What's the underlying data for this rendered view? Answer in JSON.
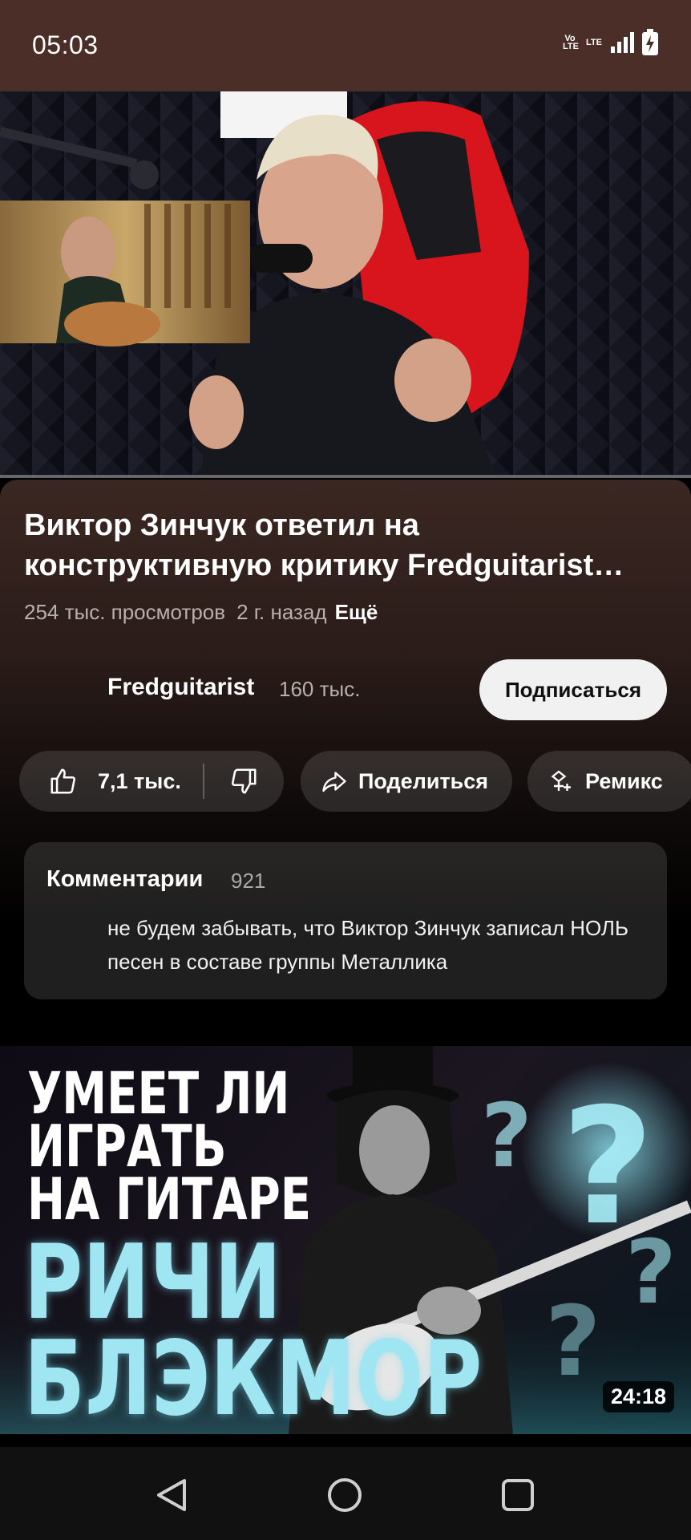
{
  "status_bar": {
    "time": "05:03",
    "volte_label": "Vo\nLTE",
    "lte_label": "LTE",
    "icons": [
      "volte-icon",
      "lte-icon",
      "signal-icon",
      "battery-charging-icon"
    ]
  },
  "player": {
    "progress_fraction": 0.0
  },
  "video": {
    "title": "Виктор Зинчук ответил на конструктивную критику Fredguitarist…",
    "views": "254 тыс. просмотров",
    "age": "2 г. назад",
    "more_label": "Ещё"
  },
  "channel": {
    "name": "Fredguitarist",
    "subscribers": "160 тыс.",
    "subscribe_label": "Подписаться"
  },
  "actions": {
    "likes": "7,1 тыс.",
    "share_label": "Поделиться",
    "remix_label": "Ремикс"
  },
  "comments": {
    "title": "Комментарии",
    "count": "921",
    "top_comment": "не будем забывать, что Виктор Зинчук записал НОЛЬ песен в составе группы Металлика"
  },
  "next_video": {
    "thumb_line1": "УМЕЕТ ЛИ",
    "thumb_line2": "ИГРАТЬ",
    "thumb_line3": "НА ГИТАРЕ",
    "thumb_line4": "РИЧИ",
    "thumb_line5": "БЛЭКМОР",
    "duration": "24:18"
  },
  "colors": {
    "status_bar": "#4a2e27",
    "accent_cyan": "#9fe6f2",
    "chair_red": "#d8141c"
  },
  "nav": {
    "icons": [
      "back-icon",
      "home-icon",
      "recents-icon"
    ]
  }
}
